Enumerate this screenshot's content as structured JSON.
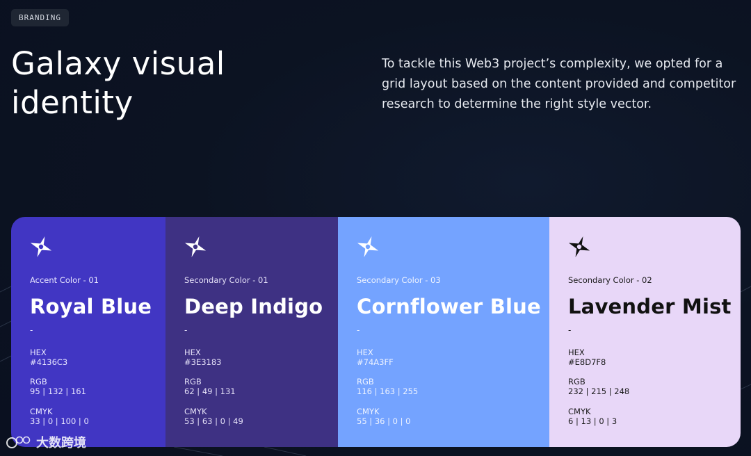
{
  "badge": "BRANDING",
  "headline": [
    "Galaxy visual",
    "identity"
  ],
  "intro": "To tackle this Web3 project’s complexity, we opted for a grid layout based on the content provided and competitor research to determine the right style vector.",
  "icons": {
    "swatch_icon": "star-logo-icon"
  },
  "swatches": [
    {
      "role": "Accent Color - 01",
      "name": "Royal Blue",
      "dash": "-",
      "hex_label": "HEX",
      "hex": "#4136C3",
      "rgb_label": "RGB",
      "rgb": "95 | 132 | 161",
      "cmyk_label": "CMYK",
      "cmyk": "33 | 0 | 100 | 0",
      "bg_color": "#4136C3",
      "text_color": "#ffffff",
      "meta_color": "#e8e6ff"
    },
    {
      "role": "Secondary Color - 01",
      "name": "Deep Indigo",
      "dash": "-",
      "hex_label": "HEX",
      "hex": "#3E3183",
      "rgb_label": "RGB",
      "rgb": "62 | 49 | 131",
      "cmyk_label": "CMYK",
      "cmyk": "53 | 63 | 0 | 49",
      "bg_color": "#3E3183",
      "text_color": "#ffffff",
      "meta_color": "#e4e0f7"
    },
    {
      "role": "Secondary Color - 03",
      "name": "Cornflower Blue",
      "dash": "-",
      "hex_label": "HEX",
      "hex": "#74A3FF",
      "rgb_label": "RGB",
      "rgb": "116 | 163 | 255",
      "cmyk_label": "CMYK",
      "cmyk": "55 | 36 | 0 | 0",
      "bg_color": "#74A3FF",
      "text_color": "#ffffff",
      "meta_color": "#eef3ff"
    },
    {
      "role": "Secondary Color - 02",
      "name": "Lavender Mist",
      "dash": "-",
      "hex_label": "HEX",
      "hex": "#E8D7F8",
      "rgb_label": "RGB",
      "rgb": "232 | 215 | 248",
      "cmyk_label": "CMYK",
      "cmyk": "6 | 13 | 0 | 3",
      "bg_color": "#E8D7F8",
      "text_color": "#111111",
      "meta_color": "#1a1a1a"
    }
  ],
  "watermark": "大数跨境"
}
